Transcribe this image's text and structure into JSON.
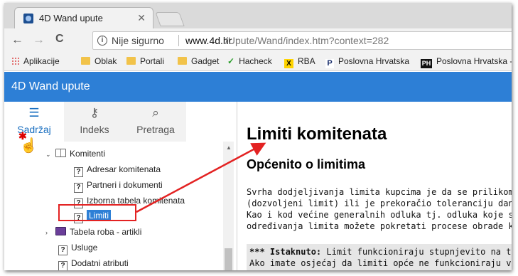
{
  "browser": {
    "tab_title": "4D Wand upute",
    "tab_close": "✕",
    "security_label": "Nije sigurno",
    "url_host": "www.4d.hr",
    "url_path": "/Upute/Wand/index.htm?context=282",
    "nav": {
      "back": "←",
      "forward": "→",
      "reload": "C",
      "info": "i"
    }
  },
  "bookmarks": [
    {
      "label": "Aplikacije",
      "icon": "apps-icon"
    },
    {
      "label": "Oblak",
      "icon": "folder-icon"
    },
    {
      "label": "Portali",
      "icon": "folder-icon"
    },
    {
      "label": "Gadget",
      "icon": "folder-icon"
    },
    {
      "label": "Hacheck",
      "icon": "check-icon"
    },
    {
      "label": "RBA",
      "icon": "rba-icon"
    },
    {
      "label": "Poslovna Hrvatska",
      "icon": "p-icon"
    },
    {
      "label": "Poslovna Hrvatska -",
      "icon": "ph-icon"
    }
  ],
  "bookmark_glyphs": {
    "rba": "X",
    "p": "P",
    "ph": "PH",
    "check": "✓"
  },
  "app": {
    "title": "4D Wand upute"
  },
  "left_tabs": [
    {
      "label": "Sadržaj",
      "icon": "list-icon",
      "glyph": "☰"
    },
    {
      "label": "Indeks",
      "icon": "key-icon",
      "glyph": "⚷"
    },
    {
      "label": "Pretraga",
      "icon": "search-icon",
      "glyph": "⌕"
    }
  ],
  "tree": {
    "komitenti": "Komitenti",
    "adresar": "Adresar komitenata",
    "partneri": "Partneri i dokumenti",
    "izborna": "Izborna tabela komitenata",
    "limiti": "Limiti",
    "tabela_roba": "Tabela roba - artikli",
    "usluge": "Usluge",
    "dodatni": "Dodatni atributi",
    "help_glyph": "?",
    "chevron_open": "⌄",
    "chevron_closed": "›"
  },
  "content": {
    "h1": "Limiti komitenata",
    "h2": "Općenito o limitima",
    "p_lines": [
      "Svrha dodjeljivanja limita kupcima je da se prilikom k",
      "(dozvoljeni limit) ili je prekoračio toleranciju dana plaća",
      "Kao i kod većine generalnih odluka tj. odluka koje se t",
      "određivanja limita možete pokretati procese obrade kre"
    ],
    "note_bold": "*** Istaknuto:",
    "note_line1": " Limit funkcioniraju stupnjevito na tri",
    "note_line2": "Ako imate osjećaj da limiti opće ne funkcioniraju već"
  },
  "annotation": {
    "color": "#e32222"
  },
  "colors": {
    "header": "#2d7fd6",
    "accent": "#1a6fc0"
  }
}
